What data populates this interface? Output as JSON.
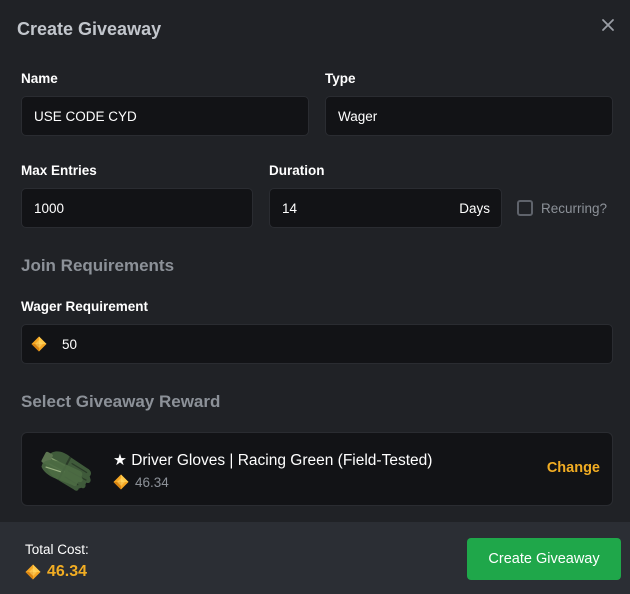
{
  "modal": {
    "title": "Create Giveaway",
    "close_icon": "close-icon"
  },
  "form": {
    "name": {
      "label": "Name",
      "value": "USE CODE CYD"
    },
    "type": {
      "label": "Type",
      "value": "Wager"
    },
    "max_entries": {
      "label": "Max Entries",
      "value": "1000"
    },
    "duration": {
      "label": "Duration",
      "value": "14",
      "suffix": "Days"
    },
    "recurring": {
      "label": "Recurring?",
      "checked": false
    }
  },
  "join_requirements": {
    "heading": "Join Requirements",
    "wager": {
      "label": "Wager Requirement",
      "value": "50",
      "icon": "coin-icon"
    }
  },
  "reward_section": {
    "heading": "Select Giveaway Reward",
    "item": {
      "name": "★ Driver Gloves | Racing Green (Field-Tested)",
      "price": "46.34",
      "image_icon": "gloves-icon",
      "change_label": "Change"
    }
  },
  "footer": {
    "total_label": "Total Cost:",
    "total_value": "46.34",
    "create_button": "Create Giveaway"
  },
  "colors": {
    "background": "#202226",
    "field": "#121316",
    "footer": "#2b2e34",
    "accent_gold": "#f2ad23",
    "button_green": "#1fa74a",
    "muted": "#8c9198"
  }
}
